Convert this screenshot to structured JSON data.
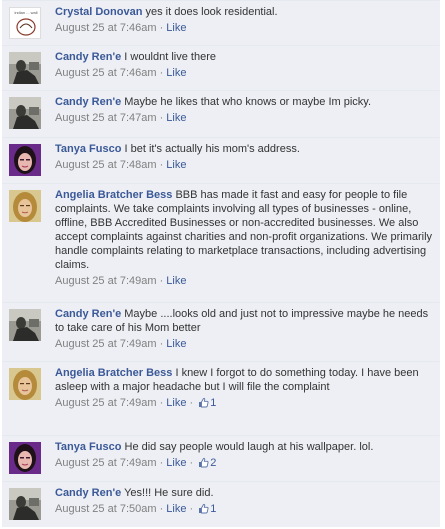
{
  "comments": [
    {
      "author": "Crystal Donovan",
      "text": "yes it does look residential.",
      "time": "August 25 at 7:46am",
      "sep": " · ",
      "like": "Like",
      "likes": null,
      "avatar": "logo-avatar",
      "avatar_text": "indian ... wall"
    },
    {
      "author": "Candy Ren'e",
      "text": "I wouldnt live there",
      "time": "August 25 at 7:46am",
      "sep": " · ",
      "like": "Like",
      "likes": null,
      "avatar": "photo-avatar-candy"
    },
    {
      "author": "Candy Ren'e",
      "text": "Maybe he likes that who knows or maybe Im picky.",
      "time": "August 25 at 7:47am",
      "sep": " · ",
      "like": "Like",
      "likes": null,
      "avatar": "photo-avatar-candy"
    },
    {
      "author": "Tanya Fusco",
      "text": "I bet it's actually his mom's address.",
      "time": "August 25 at 7:48am",
      "sep": " · ",
      "like": "Like",
      "likes": null,
      "avatar": "photo-avatar-tanya"
    },
    {
      "author": "Angelia Bratcher Bess",
      "text": "BBB has made it fast and easy for people to file complaints. We take complaints involving all types of businesses - online, offline, BBB Accredited Businesses or non-accredited businesses. We also accept complaints against charities and non-profit organizations. We primarily handle complaints relating to marketplace transactions, including advertising claims.",
      "time": "August 25 at 7:49am",
      "sep": " · ",
      "like": "Like",
      "likes": null,
      "avatar": "photo-avatar-angelia"
    },
    {
      "author": "Candy Ren'e",
      "text": "Maybe ....looks old and just not to impressive maybe he needs to take care of his Mom better",
      "time": "August 25 at 7:49am",
      "sep": " · ",
      "like": "Like",
      "likes": null,
      "avatar": "photo-avatar-candy"
    },
    {
      "author": "Angelia Bratcher Bess",
      "text": "I knew I forgot to do something today. I have been asleep with a major headache but I will file the complaint",
      "time": "August 25 at 7:49am",
      "sep": " · ",
      "like": "Like",
      "likes": "1",
      "avatar": "photo-avatar-angelia"
    },
    {
      "author": "Tanya Fusco",
      "text": "He did say people would laugh at his wallpaper. lol.",
      "time": "August 25 at 7:49am",
      "sep": " · ",
      "like": "Like",
      "likes": "2",
      "avatar": "photo-avatar-tanya"
    },
    {
      "author": "Candy Ren'e",
      "text": "Yes!!! He sure did.",
      "time": "August 25 at 7:50am",
      "sep": " · ",
      "like": "Like",
      "likes": "1",
      "avatar": "photo-avatar-candy"
    }
  ],
  "colors": {
    "link": "#3b5998",
    "meta": "#808080",
    "row_bg": "#edeff4",
    "divider": "#e5eaf1"
  }
}
